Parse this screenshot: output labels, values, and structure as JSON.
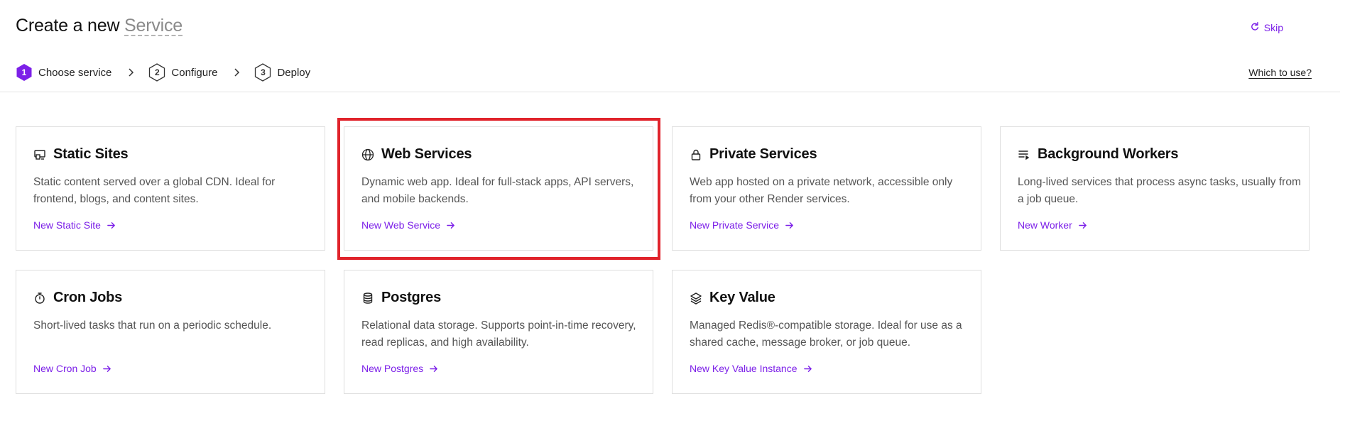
{
  "header": {
    "title_prefix": "Create a new",
    "title_kind": "Service",
    "skip_label": "Skip",
    "which_label": "Which to use?"
  },
  "stepper": {
    "steps": [
      {
        "number": "1",
        "label": "Choose service",
        "state": "active"
      },
      {
        "number": "2",
        "label": "Configure",
        "state": "pending"
      },
      {
        "number": "3",
        "label": "Deploy",
        "state": "pending"
      }
    ]
  },
  "cards": [
    {
      "title": "Static Sites",
      "icon": "static-site-icon",
      "description": "Static content served over a global CDN. Ideal for frontend, blogs, and content sites.",
      "link": "New Static Site"
    },
    {
      "title": "Web Services",
      "icon": "globe-icon",
      "description": "Dynamic web app. Ideal for full-stack apps, API servers, and mobile backends.",
      "link": "New Web Service"
    },
    {
      "title": "Private Services",
      "icon": "lock-icon",
      "description": "Web app hosted on a private network, accessible only from your other Render services.",
      "link": "New Private Service"
    },
    {
      "title": "Background Workers",
      "icon": "queue-icon",
      "description": "Long-lived services that process async tasks, usually from a job queue.",
      "link": "New Worker"
    },
    {
      "title": "Cron Jobs",
      "icon": "stopwatch-icon",
      "description": "Short-lived tasks that run on a periodic schedule.",
      "link": "New Cron Job"
    },
    {
      "title": "Postgres",
      "icon": "database-icon",
      "description": "Relational data storage. Supports point-in-time recovery, read replicas, and high availability.",
      "link": "New Postgres"
    },
    {
      "title": "Key Value",
      "icon": "layers-icon",
      "description": "Managed Redis®-compatible storage. Ideal for use as a shared cache, message broker, or job queue.",
      "link": "New Key Value Instance"
    }
  ],
  "colors": {
    "accent": "#7c20e8",
    "highlight": "#e0232b",
    "border": "#dedede",
    "muted_text": "#555555"
  }
}
